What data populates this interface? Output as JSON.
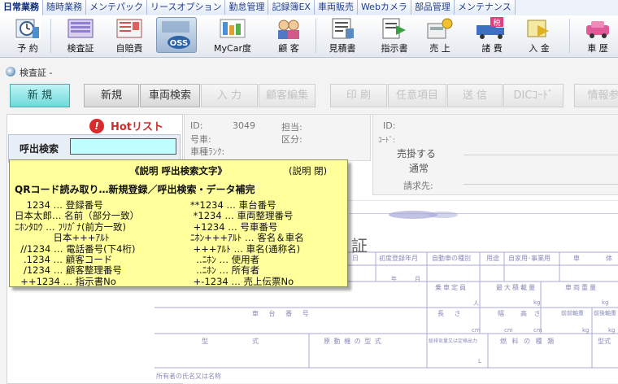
{
  "tabs": [
    {
      "label": "日常業務",
      "active": true
    },
    {
      "label": "随時業務",
      "active": false
    },
    {
      "label": "メンテパック",
      "active": false
    },
    {
      "label": "リースオプション",
      "active": false
    },
    {
      "label": "勤怠管理",
      "active": false
    },
    {
      "label": "記録簿EX",
      "active": false
    },
    {
      "label": "車両販売",
      "active": false
    },
    {
      "label": "Webカメラ",
      "active": false
    },
    {
      "label": "部品管理",
      "active": false
    },
    {
      "label": "メンテナンス",
      "active": false
    }
  ],
  "toolbar": {
    "items": [
      {
        "label": "予 約",
        "icon": "clock-calendar-icon"
      },
      {
        "label": "検査証",
        "icon": "inspection-certificate-icon"
      },
      {
        "label": "自賠責",
        "icon": "insurance-document-icon"
      },
      {
        "label": "",
        "icon": "oss-icon",
        "badge": "OSS"
      },
      {
        "label": "MyCar度",
        "icon": "mycar-rating-icon"
      },
      {
        "label": "顧 客",
        "icon": "customers-icon"
      },
      {
        "label": "見積書",
        "icon": "estimate-icon"
      },
      {
        "label": "指示書",
        "icon": "work-order-icon"
      },
      {
        "label": "売 上",
        "icon": "sales-icon"
      },
      {
        "label": "諸 費",
        "icon": "expenses-truck-icon",
        "badge": "税"
      },
      {
        "label": "入 金",
        "icon": "payment-icon"
      },
      {
        "label": "車 歴",
        "icon": "vehicle-history-icon"
      }
    ]
  },
  "window": {
    "title": "検査証 -"
  },
  "buttons": {
    "new_mode": "新 規",
    "new": "新規",
    "vehicle_search": "車両検索",
    "input": "入 力",
    "customer_edit": "顧客編集",
    "print": "印 刷",
    "optional": "任意項目",
    "send": "送 信",
    "dic_code": "DICｺｰﾄﾞ",
    "info_ref": "情報参"
  },
  "hotlist": {
    "label": "Hotリスト"
  },
  "callout": {
    "label": "呼出検索",
    "value": ""
  },
  "info": {
    "id_label": "ID:",
    "id_value": "3049",
    "staff_label": "担当:",
    "number_label": "号車:",
    "category_label": "区分:",
    "rank_label": "車種ﾗﾝｸ:",
    "id2_label": "ID:",
    "code_label": "ｺｰﾄﾞ:",
    "credit_label": "売掛する",
    "normal_label": "通常",
    "billing_label": "請求先:"
  },
  "popup": {
    "title": "《説明 呼出検索文字》",
    "close": "(説明 閉)",
    "heading": "QRコード読み取り…新規登録／呼出検索・データ補完",
    "rows": [
      {
        "left": "    1234 … 登録番号",
        "right": "**1234 … 車台番号"
      },
      {
        "left": "日本太郎… 名前（部分一致）",
        "right": " *1234 … 車両整理番号"
      },
      {
        "left": "ﾆﾎﾝﾀﾛｳ … ﾌﾘｶﾞﾅ(前方一致)",
        "right": " +1234 … 号車番号"
      },
      {
        "left": "             日本+++ｱﾙﾄ",
        "right": "ﾆﾎﾝ+++ｱﾙﾄ … 客名＆車名"
      },
      {
        "left": "  //1234 … 電話番号(下4桁)",
        "right": " +++ｱﾙﾄ … 車名(通称名)"
      },
      {
        "left": "   .1234 … 顧客コード",
        "right": "  ..ﾆﾎﾝ … 使用者"
      },
      {
        "left": "   /1234 … 顧客整理番号",
        "right": "  ..ﾆﾎﾝ … 所有者"
      },
      {
        "left": "  ++1234 … 指示書No",
        "right": " +-1234 … 売上伝票No"
      }
    ]
  },
  "document": {
    "title": "証",
    "row1": [
      "日",
      "初度登録年月",
      "自動車の種別",
      "用途",
      "自家用･事業用",
      "車",
      "体"
    ],
    "row1_sub": [
      "年",
      "月"
    ],
    "row2": [
      "乗車定員",
      "最大積載量",
      "車両重量"
    ],
    "row2_units": [
      "人",
      "kg",
      "kg"
    ],
    "row3": [
      "車 台 番 号",
      "長 さ",
      "幅",
      "高 さ",
      "前前軸重",
      "前後軸重"
    ],
    "row3_units": [
      "cm",
      "cm",
      "cm",
      "kg",
      "kg"
    ],
    "row4": [
      "型",
      "式",
      "原 動 機 の 型 式",
      "総排気量又は定格出力",
      "燃 料 の 種 類",
      "型式"
    ],
    "row4_units": [
      "L"
    ],
    "row5": [
      "所有者の氏名又は名称"
    ]
  },
  "colors": {
    "popup_bg": "#ffff9c",
    "input_bg": "#bfffff",
    "new_btn": "#7fe0e0",
    "doc_line": "#a8a8d8"
  }
}
